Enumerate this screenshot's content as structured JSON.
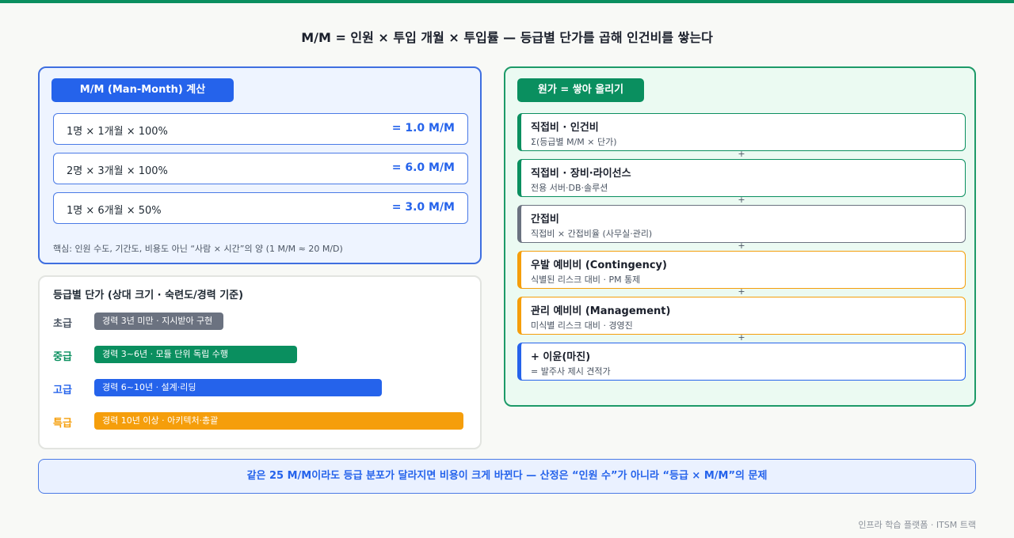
{
  "title": "M/M = 인원 × 투입 개월 × 투입률 — 등급별 단가를 곱해 인건비를 쌓는다",
  "mm_calc": {
    "header": "M/M (Man-Month) 계산",
    "rows": [
      {
        "expr": "1명 × 1개월 × 100%",
        "result": "= 1.0 M/M"
      },
      {
        "expr": "2명 × 3개월 × 100%",
        "result": "= 6.0 M/M"
      },
      {
        "expr": "1명 × 6개월 × 50%",
        "result": "= 3.0 M/M"
      }
    ],
    "note": "핵심: 인원 수도, 기간도, 비용도 아닌 “사람 × 시간”의 양 (1 M/M ≈ 20 M/D)"
  },
  "grades": {
    "title": "등급별 단가 (상대 크기 · 숙련도/경력 기준)",
    "items": [
      {
        "label": "초급",
        "desc": "경력 3년 미만 · 지시받아 구현",
        "relative_size": 0.35,
        "color": "#6b7280"
      },
      {
        "label": "중급",
        "desc": "경력 3~6년 · 모듈 단위 독립 수행",
        "relative_size": 0.55,
        "color": "#0a8f5f"
      },
      {
        "label": "고급",
        "desc": "경력 6~10년 · 설계·리딩",
        "relative_size": 0.78,
        "color": "#2563eb"
      },
      {
        "label": "특급",
        "desc": "경력 10년 이상 · 아키텍처·총괄",
        "relative_size": 1.0,
        "color": "#f59e0b"
      }
    ]
  },
  "cost": {
    "header": "원가 = 쌓아 올리기",
    "plus_sign": "+",
    "items": [
      {
        "name": "직접비 · 인건비",
        "desc": "Σ(등급별 M/M × 단가)",
        "color": "#0a8f5f"
      },
      {
        "name": "직접비 · 장비·라이선스",
        "desc": "전용 서버·DB·솔루션",
        "color": "#0a8f5f"
      },
      {
        "name": "간접비",
        "desc": "직접비 × 간접비율 (사무실·관리)",
        "color": "#6b7280"
      },
      {
        "name": "우발 예비비 (Contingency)",
        "desc": "식별된 리스크 대비 · PM 통제",
        "color": "#f59e0b"
      },
      {
        "name": "관리 예비비 (Management)",
        "desc": "미식별 리스크 대비 · 경영진",
        "color": "#f59e0b"
      },
      {
        "name": "+ 이윤(마진)",
        "desc": "= 발주사 제시 견적가",
        "color": "#2563eb"
      }
    ]
  },
  "footer": "같은 25 M/M이라도 등급 분포가 달라지면 비용이 크게 바뀐다 — 산정은 “인원 수”가 아니라 “등급 × M/M”의 문제",
  "credit": "인프라 학습 플랫폼 · ITSM 트랙"
}
